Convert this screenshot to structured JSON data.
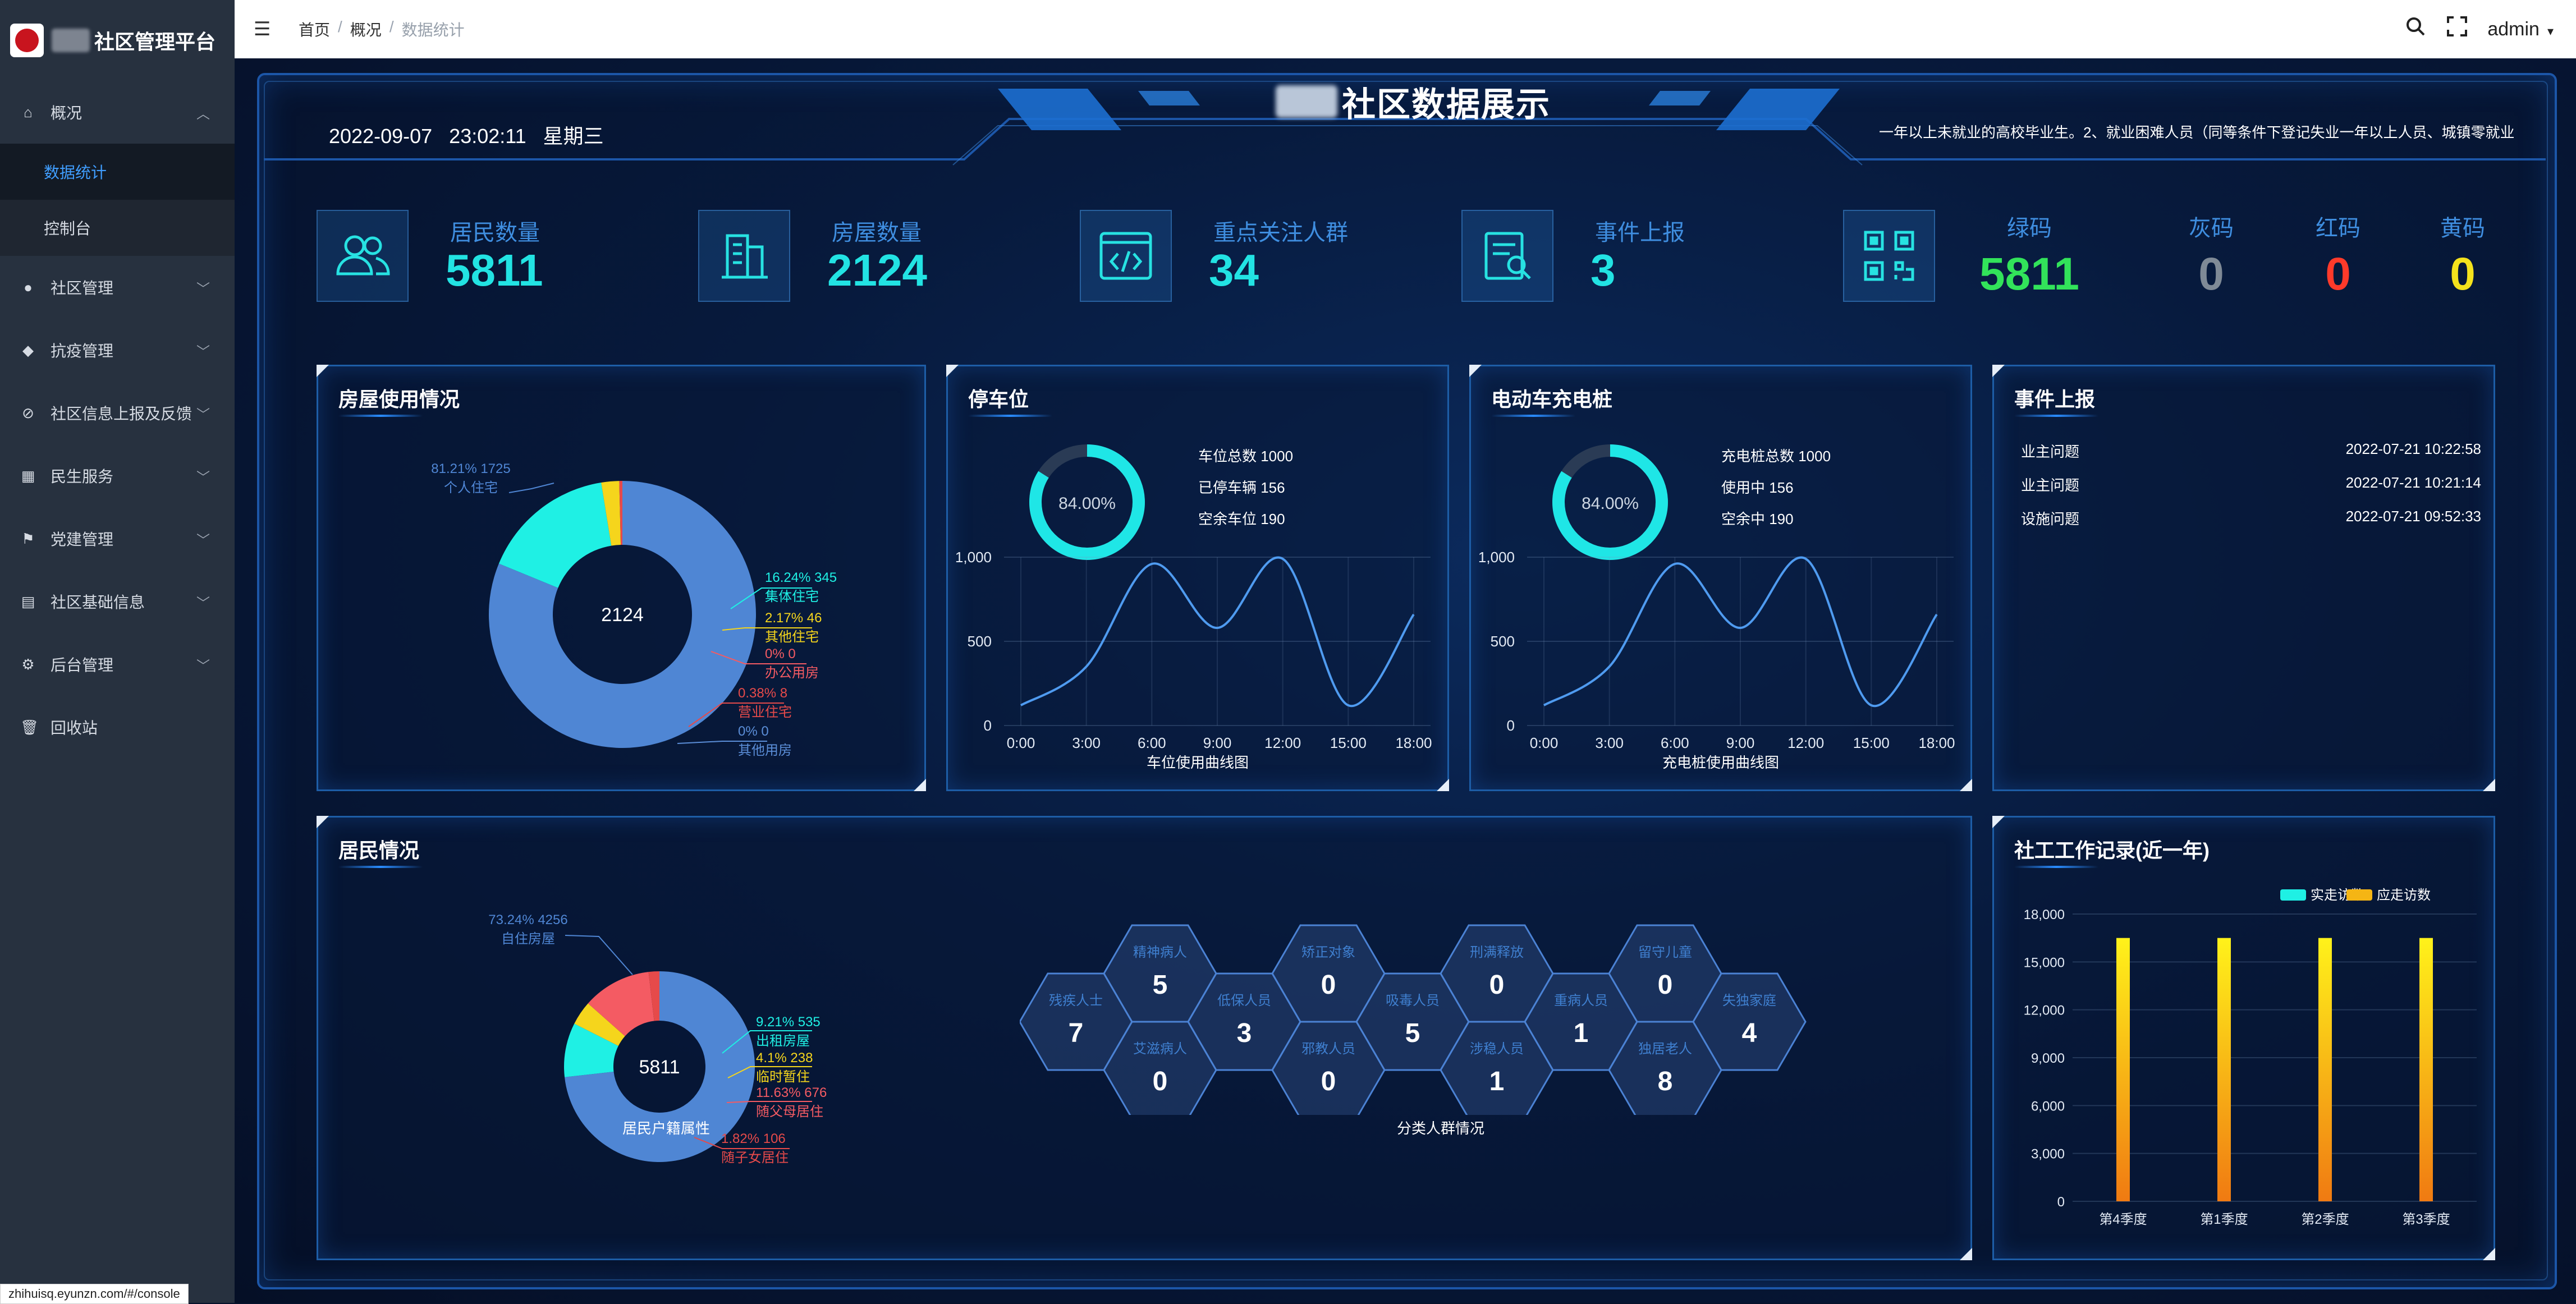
{
  "app": {
    "name": "社区管理平台"
  },
  "sidebar": {
    "items": [
      {
        "label": "概况",
        "icon": "home-icon"
      },
      {
        "label": "社区管理",
        "icon": "user-icon"
      },
      {
        "label": "抗疫管理",
        "icon": "shield-icon"
      },
      {
        "label": "社区信息上报及反馈",
        "icon": "paperclip-icon"
      },
      {
        "label": "民生服务",
        "icon": "building-icon"
      },
      {
        "label": "党建管理",
        "icon": "flag-icon"
      },
      {
        "label": "社区基础信息",
        "icon": "document-icon"
      },
      {
        "label": "后台管理",
        "icon": "gear-icon"
      },
      {
        "label": "回收站",
        "icon": "trash-icon"
      }
    ],
    "sub_items": [
      {
        "label": "数据统计",
        "active": true
      },
      {
        "label": "控制台",
        "active": false
      }
    ]
  },
  "topbar": {
    "breadcrumb": [
      "首页",
      "概况",
      "数据统计"
    ],
    "user": "admin"
  },
  "screen": {
    "title": "社区数据展示",
    "date": "2022-09-07",
    "time": "23:02:11",
    "weekday": "星期三",
    "marquee": "一年以上未就业的高校毕业生。2、就业困难人员（同等条件下登记失业一年以上人员、城镇零就业"
  },
  "stats": [
    {
      "label": "居民数量",
      "value": "5811",
      "icon": "people-icon"
    },
    {
      "label": "房屋数量",
      "value": "2124",
      "icon": "building-icon"
    },
    {
      "label": "重点关注人群",
      "value": "34",
      "icon": "code-icon"
    },
    {
      "label": "事件上报",
      "value": "3",
      "icon": "report-icon"
    }
  ],
  "codes": [
    {
      "label": "绿码",
      "value": "5811",
      "color": "#32e35a"
    },
    {
      "label": "灰码",
      "value": "0",
      "color": "#7f8a96"
    },
    {
      "label": "红码",
      "value": "0",
      "color": "#ff3a2a"
    },
    {
      "label": "黄码",
      "value": "0",
      "color": "#f4e21c"
    }
  ],
  "panels": {
    "housing": {
      "title": "房屋使用情况"
    },
    "parking": {
      "title": "停车位",
      "gauge_label": "84.00%",
      "lines": [
        "车位总数 1000",
        "已停车辆 156",
        "空余车位 190"
      ],
      "chart_label": "车位使用曲线图"
    },
    "charging": {
      "title": "电动车充电桩",
      "gauge_label": "84.00%",
      "lines": [
        "充电桩总数 1000",
        "使用中 156",
        "空余中 190"
      ],
      "chart_label": "充电桩使用曲线图"
    },
    "events": {
      "title": "事件上报",
      "rows": [
        {
          "name": "业主问题",
          "time": "2022-07-21 10:22:58"
        },
        {
          "name": "业主问题",
          "time": "2022-07-21 10:21:14"
        },
        {
          "name": "设施问题",
          "time": "2022-07-21 09:52:33"
        }
      ]
    },
    "residents": {
      "title": "居民情况",
      "donut_label": "居民户籍属性",
      "hex_label": "分类人群情况"
    },
    "social": {
      "title": "社工工作记录(近一年)"
    }
  },
  "hexes": [
    {
      "label": "残疾人士",
      "value": "7"
    },
    {
      "label": "精神病人",
      "value": "5"
    },
    {
      "label": "艾滋病人",
      "value": "0"
    },
    {
      "label": "低保人员",
      "value": "3"
    },
    {
      "label": "矫正对象",
      "value": "0"
    },
    {
      "label": "邪教人员",
      "value": "0"
    },
    {
      "label": "吸毒人员",
      "value": "5"
    },
    {
      "label": "刑满释放",
      "value": "0"
    },
    {
      "label": "涉稳人员",
      "value": "1"
    },
    {
      "label": "重病人员",
      "value": "1"
    },
    {
      "label": "留守儿童",
      "value": "0"
    },
    {
      "label": "独居老人",
      "value": "8"
    },
    {
      "label": "失独家庭",
      "value": "4"
    }
  ],
  "status": {
    "url": "zhihuisq.eyunzn.com/#/console"
  },
  "chart_data": [
    {
      "type": "pie",
      "center_label": "2124",
      "slices": [
        {
          "name": "个人住宅",
          "value": 1725,
          "percent": "81.21%",
          "color": "#4f86d4"
        },
        {
          "name": "集体住宅",
          "value": 345,
          "percent": "16.24%",
          "color": "#1ff0e4"
        },
        {
          "name": "其他住宅",
          "value": 46,
          "percent": "2.17%",
          "color": "#f5d51c"
        },
        {
          "name": "办公用房",
          "value": 0,
          "percent": "0%",
          "color": "#f45b63"
        },
        {
          "name": "营业住宅",
          "value": 8,
          "percent": "0.38%",
          "color": "#e64a4a"
        },
        {
          "name": "其他用房",
          "value": 0,
          "percent": "0%",
          "color": "#5b8ed8"
        }
      ]
    },
    {
      "type": "line",
      "x": [
        "0:00",
        "3:00",
        "6:00",
        "9:00",
        "12:00",
        "15:00",
        "18:00"
      ],
      "series": [
        {
          "values": [
            120,
            350,
            960,
            580,
            990,
            120,
            660
          ]
        }
      ],
      "ylim": [
        0,
        1000
      ],
      "yticks": [
        0,
        500,
        1000
      ]
    },
    {
      "type": "line",
      "x": [
        "0:00",
        "3:00",
        "6:00",
        "9:00",
        "12:00",
        "15:00",
        "18:00"
      ],
      "series": [
        {
          "values": [
            120,
            350,
            960,
            580,
            990,
            120,
            660
          ]
        }
      ],
      "ylim": [
        0,
        1000
      ],
      "yticks": [
        0,
        500,
        1000
      ]
    },
    {
      "type": "pie",
      "center_label": "5811",
      "slices": [
        {
          "name": "自住房屋",
          "value": 4256,
          "percent": "73.24%",
          "color": "#4f86d4"
        },
        {
          "name": "出租房屋",
          "value": 535,
          "percent": "9.21%",
          "color": "#1ff0e4"
        },
        {
          "name": "临时暂住",
          "value": 238,
          "percent": "4.1%",
          "color": "#f5d51c"
        },
        {
          "name": "随父母居住",
          "value": 676,
          "percent": "11.63%",
          "color": "#f45b63"
        },
        {
          "name": "随子女居住",
          "value": 106,
          "percent": "1.82%",
          "color": "#e64a4a"
        }
      ]
    },
    {
      "type": "bar",
      "categories": [
        "第4季度",
        "第1季度",
        "第2季度",
        "第3季度"
      ],
      "series": [
        {
          "name": "实走访数",
          "values": [
            0,
            0,
            0,
            0
          ],
          "color": "#1ff0e4"
        },
        {
          "name": "应走访数",
          "values": [
            16500,
            16500,
            16500,
            16500
          ],
          "color": "#f5b514"
        }
      ],
      "ylim": [
        0,
        18000
      ],
      "yticks": [
        0,
        3000,
        6000,
        9000,
        12000,
        15000,
        18000
      ]
    }
  ]
}
